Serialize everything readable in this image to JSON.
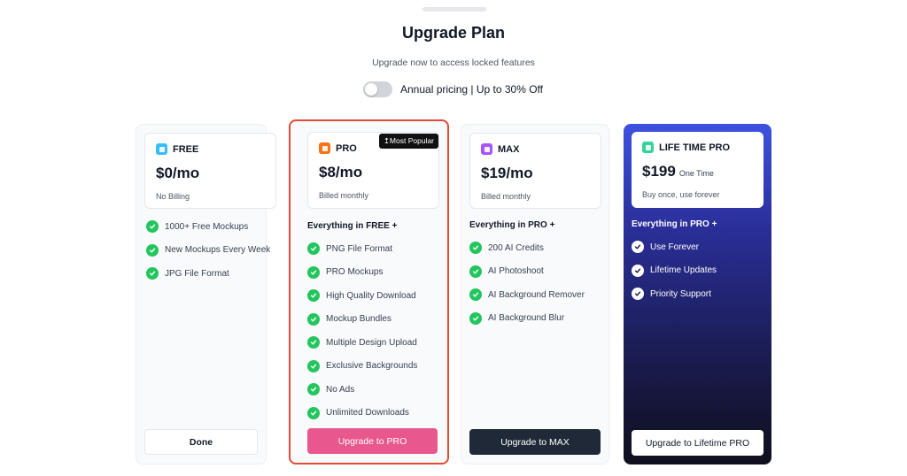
{
  "header": {
    "title": "Upgrade Plan",
    "subtitle": "Upgrade now to access locked features",
    "toggle_label": "Annual pricing | Up to 30% Off",
    "toggle_on": false
  },
  "plans": [
    {
      "name": "FREE",
      "icon": "sparkle-icon",
      "icon_color": "#38bdf8",
      "price": "$0/mo",
      "price_note": "",
      "billing": "No Billing",
      "everything": "",
      "features": [
        "1000+ Free Mockups",
        "New Mockups Every Week",
        "JPG File Format"
      ],
      "button": "Done"
    },
    {
      "name": "PRO",
      "icon": "star-icon",
      "icon_color": "#f97316",
      "badge": "↥Most Popular",
      "price": "$8/mo",
      "price_note": "",
      "billing": "Billed monthly",
      "everything": "Everything in FREE +",
      "features": [
        "PNG File Format",
        "PRO Mockups",
        "High Quality Download",
        "Mockup Bundles",
        "Multiple Design Upload",
        "Exclusive Backgrounds",
        "No Ads",
        "Unlimited Downloads"
      ],
      "button": "Upgrade to PRO",
      "accent": "#e8578d"
    },
    {
      "name": "MAX",
      "icon": "diamond-icon",
      "icon_color": "#a855f7",
      "price": "$19/mo",
      "price_note": "",
      "billing": "Billed monthly",
      "everything": "Everything in PRO +",
      "features": [
        "200 AI Credits",
        "AI Photoshoot",
        "AI Background Remover",
        "AI Background Blur"
      ],
      "button": "Upgrade to MAX"
    },
    {
      "name": "LIFE TIME PRO",
      "icon": "infinity-icon",
      "icon_color": "#34d399",
      "price": "$199",
      "price_note": "One Time",
      "billing": "Buy once, use forever",
      "everything": "Everything in PRO +",
      "features": [
        "Use Forever",
        "Lifetime Updates",
        "Priority Support"
      ],
      "button": "Upgrade to Lifetime PRO"
    }
  ],
  "colors": {
    "highlight_border": "#e24a36",
    "check_green": "#22c55e",
    "dark_button": "#1f2937"
  }
}
